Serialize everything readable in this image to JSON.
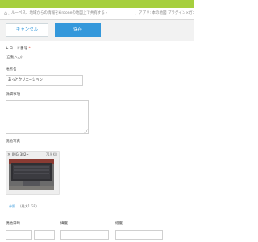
{
  "tabs": {
    "home_icon": "⌂",
    "separator": "›",
    "tab1_label": "ルーペス、地域からの情報をkintoneの地図上で共有する ›",
    "tab2_label": "アプリ: 本の地図 プラグイン×ガンツン"
  },
  "toolbar": {
    "cancel_label": "キャンセル",
    "save_label": "保存"
  },
  "form": {
    "record_no_label": "レコード番号",
    "required_mark": "*",
    "record_no_value": "(自動入力)",
    "location_label": "地点名",
    "location_value": "あっとクリエーション",
    "detail_label": "詳細事項",
    "photo_label": "現地写真",
    "date_label": "現地日時",
    "time_label": "緯度",
    "lat_label": "経度"
  },
  "attachment": {
    "close_icon": "×",
    "filename": "IMG_382~",
    "size": "719 KB",
    "browse_label": "参照",
    "max_label": "(最大1 GB)"
  },
  "colors": {
    "accent": "#3498db",
    "top_band": "#a6cf3e",
    "required": "#e74c3c"
  }
}
